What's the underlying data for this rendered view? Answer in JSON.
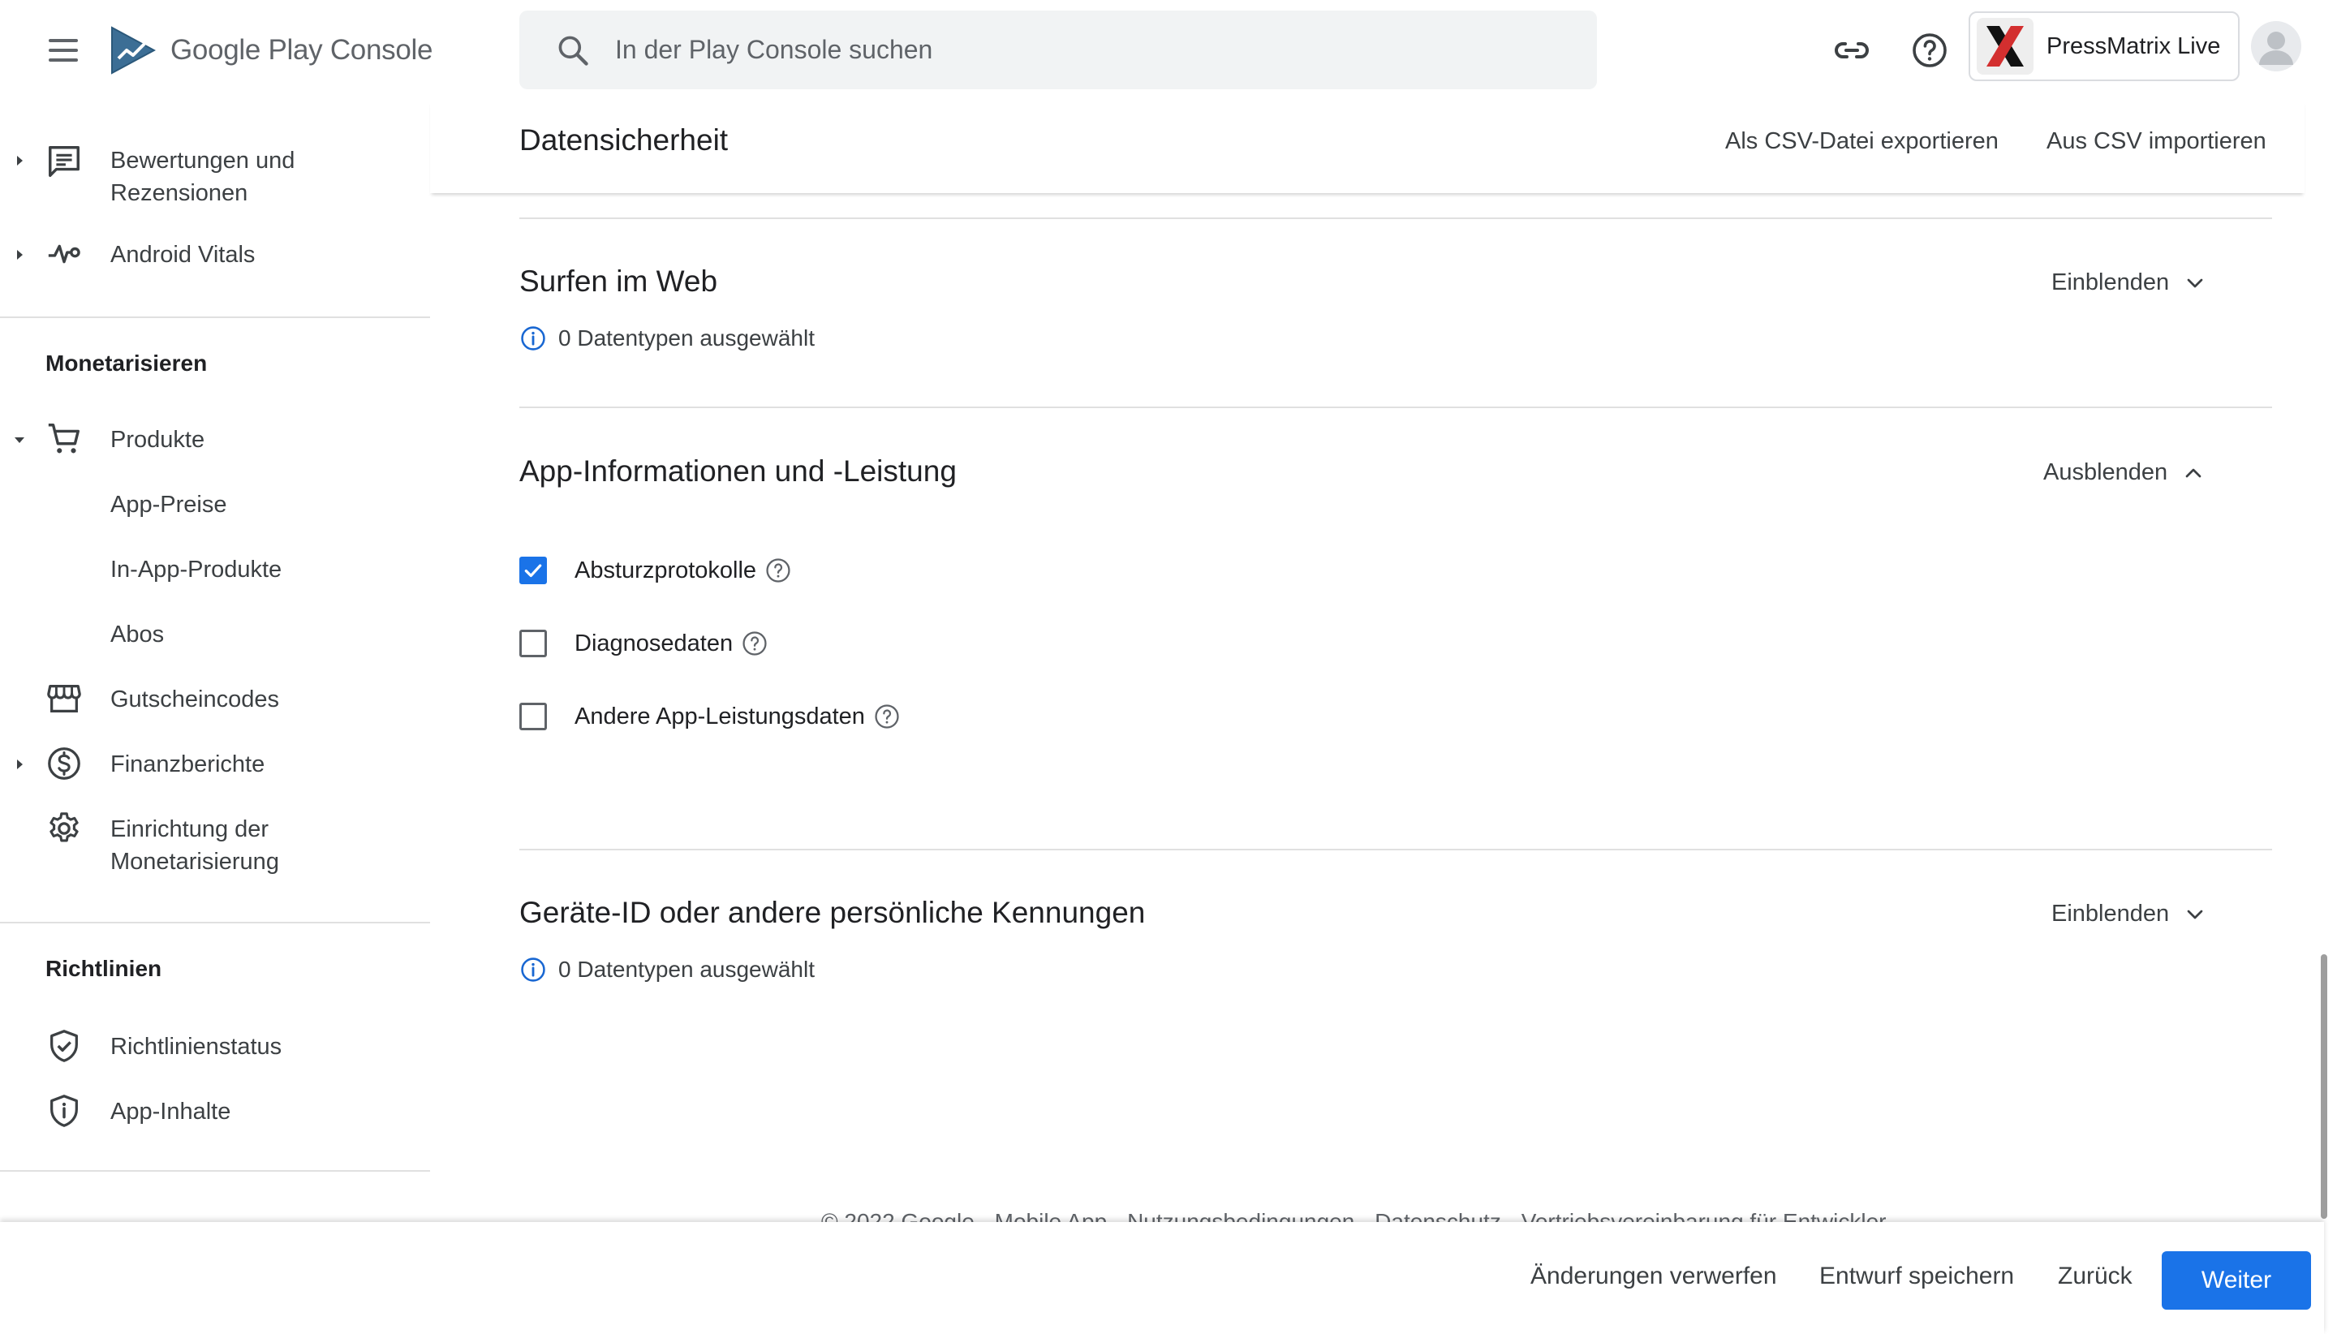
{
  "topbar": {
    "logo_text_main": "Google Play",
    "logo_text_suffix": "Console",
    "search_placeholder": "In der Play Console suchen",
    "app_name": "PressMatrix Live"
  },
  "sidebar": {
    "items": [
      {
        "label": "Bewertungen und Rezensionen",
        "icon": "reviews-icon"
      },
      {
        "label": "Android Vitals",
        "icon": "vitals-icon"
      }
    ],
    "monetize": {
      "section": "Monetarisieren",
      "products": "Produkte",
      "sub": [
        "App-Preise",
        "In-App-Produkte",
        "Abos"
      ],
      "promo_codes": "Gutscheincodes",
      "financial_reports": "Finanzberichte",
      "monetization_setup": "Einrichtung der Monetarisierung"
    },
    "policy": {
      "section": "Richtlinien",
      "policy_status": "Richtlinienstatus",
      "app_content": "App-Inhalte"
    }
  },
  "header": {
    "title": "Datensicherheit",
    "export_csv": "Als CSV-Datei exportieren",
    "import_csv": "Aus CSV importieren"
  },
  "sections": {
    "web": {
      "title": "Surfen im Web",
      "toggle": "Einblenden",
      "info": "0 Datentypen ausgewählt"
    },
    "app_info": {
      "title": "App-Informationen und -Leistung",
      "toggle": "Ausblenden",
      "options": [
        {
          "label": "Absturzprotokolle",
          "checked": true
        },
        {
          "label": "Diagnosedaten",
          "checked": false
        },
        {
          "label": "Andere App-Leistungsdaten",
          "checked": false
        }
      ]
    },
    "device_id": {
      "title": "Geräte-ID oder andere persönliche Kennungen",
      "toggle": "Einblenden",
      "info": "0 Datentypen ausgewählt"
    }
  },
  "footer": {
    "text": "© 2022 Google · Mobile App · Nutzungsbedingungen · Datenschutz · Vertriebsvereinbarung für Entwickler"
  },
  "actions": {
    "discard": "Änderungen verwerfen",
    "save_draft": "Entwurf speichern",
    "back": "Zurück",
    "next": "Weiter"
  },
  "colors": {
    "primary": "#1a73e8",
    "text": "#202124",
    "secondary_text": "#5f6368",
    "divider": "#e0e0e0"
  }
}
